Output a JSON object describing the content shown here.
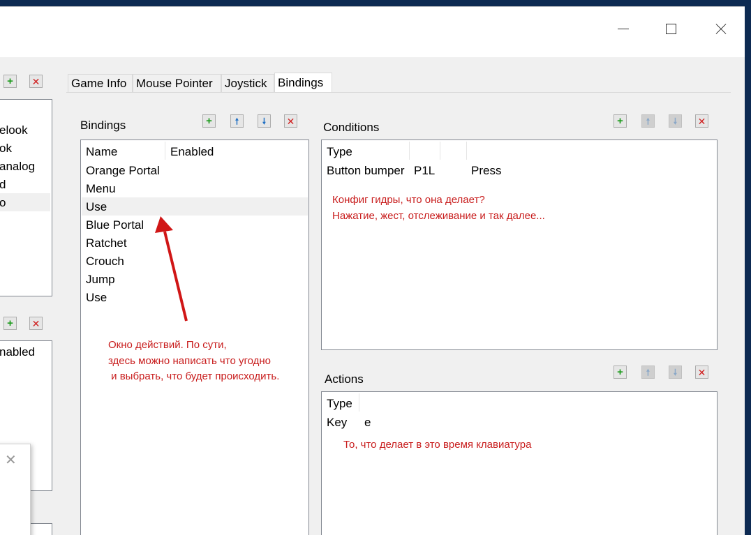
{
  "tabs": [
    "Game Info",
    "Mouse Pointer",
    "Joystick",
    "Bindings"
  ],
  "left_panel": {
    "items_top": [
      "elook",
      "ok",
      "analog",
      "d",
      "o"
    ],
    "item_bottom": "nabled"
  },
  "bindings": {
    "title": "Bindings",
    "columns": [
      "Name",
      "Enabled"
    ],
    "rows": [
      "Orange Portal",
      "Menu",
      "Use",
      "Blue Portal",
      "Ratchet",
      "Crouch",
      "Jump",
      "Use"
    ],
    "note": [
      "Окно действий. По сути,",
      "здесь можно написать что угодно",
      " и выбрать, что будет происходить."
    ]
  },
  "conditions": {
    "title": "Conditions",
    "columns": [
      "Type",
      "",
      "",
      ""
    ],
    "row": [
      "Button bumper",
      "P1L",
      "",
      "Press"
    ],
    "note": [
      "Конфиг гидры, что она делает?",
      "Нажатие, жест, отслеживание и так далее..."
    ]
  },
  "actions": {
    "title": "Actions",
    "columns": [
      "Type"
    ],
    "row": [
      "Key",
      "e"
    ],
    "note": "То, что делает в это время клавиатура"
  },
  "icons": {
    "add": "+",
    "remove": "✕",
    "up": "🠕",
    "down": "🠗",
    "minimize": "minimize-icon",
    "maximize": "maximize-icon",
    "close": "close-icon"
  },
  "colors": {
    "annotation": "#c81c1c",
    "arrow": "#d01616",
    "add_green": "#1a9a1a",
    "remove_red": "#d02020",
    "move_blue": "#1f6fc4"
  }
}
